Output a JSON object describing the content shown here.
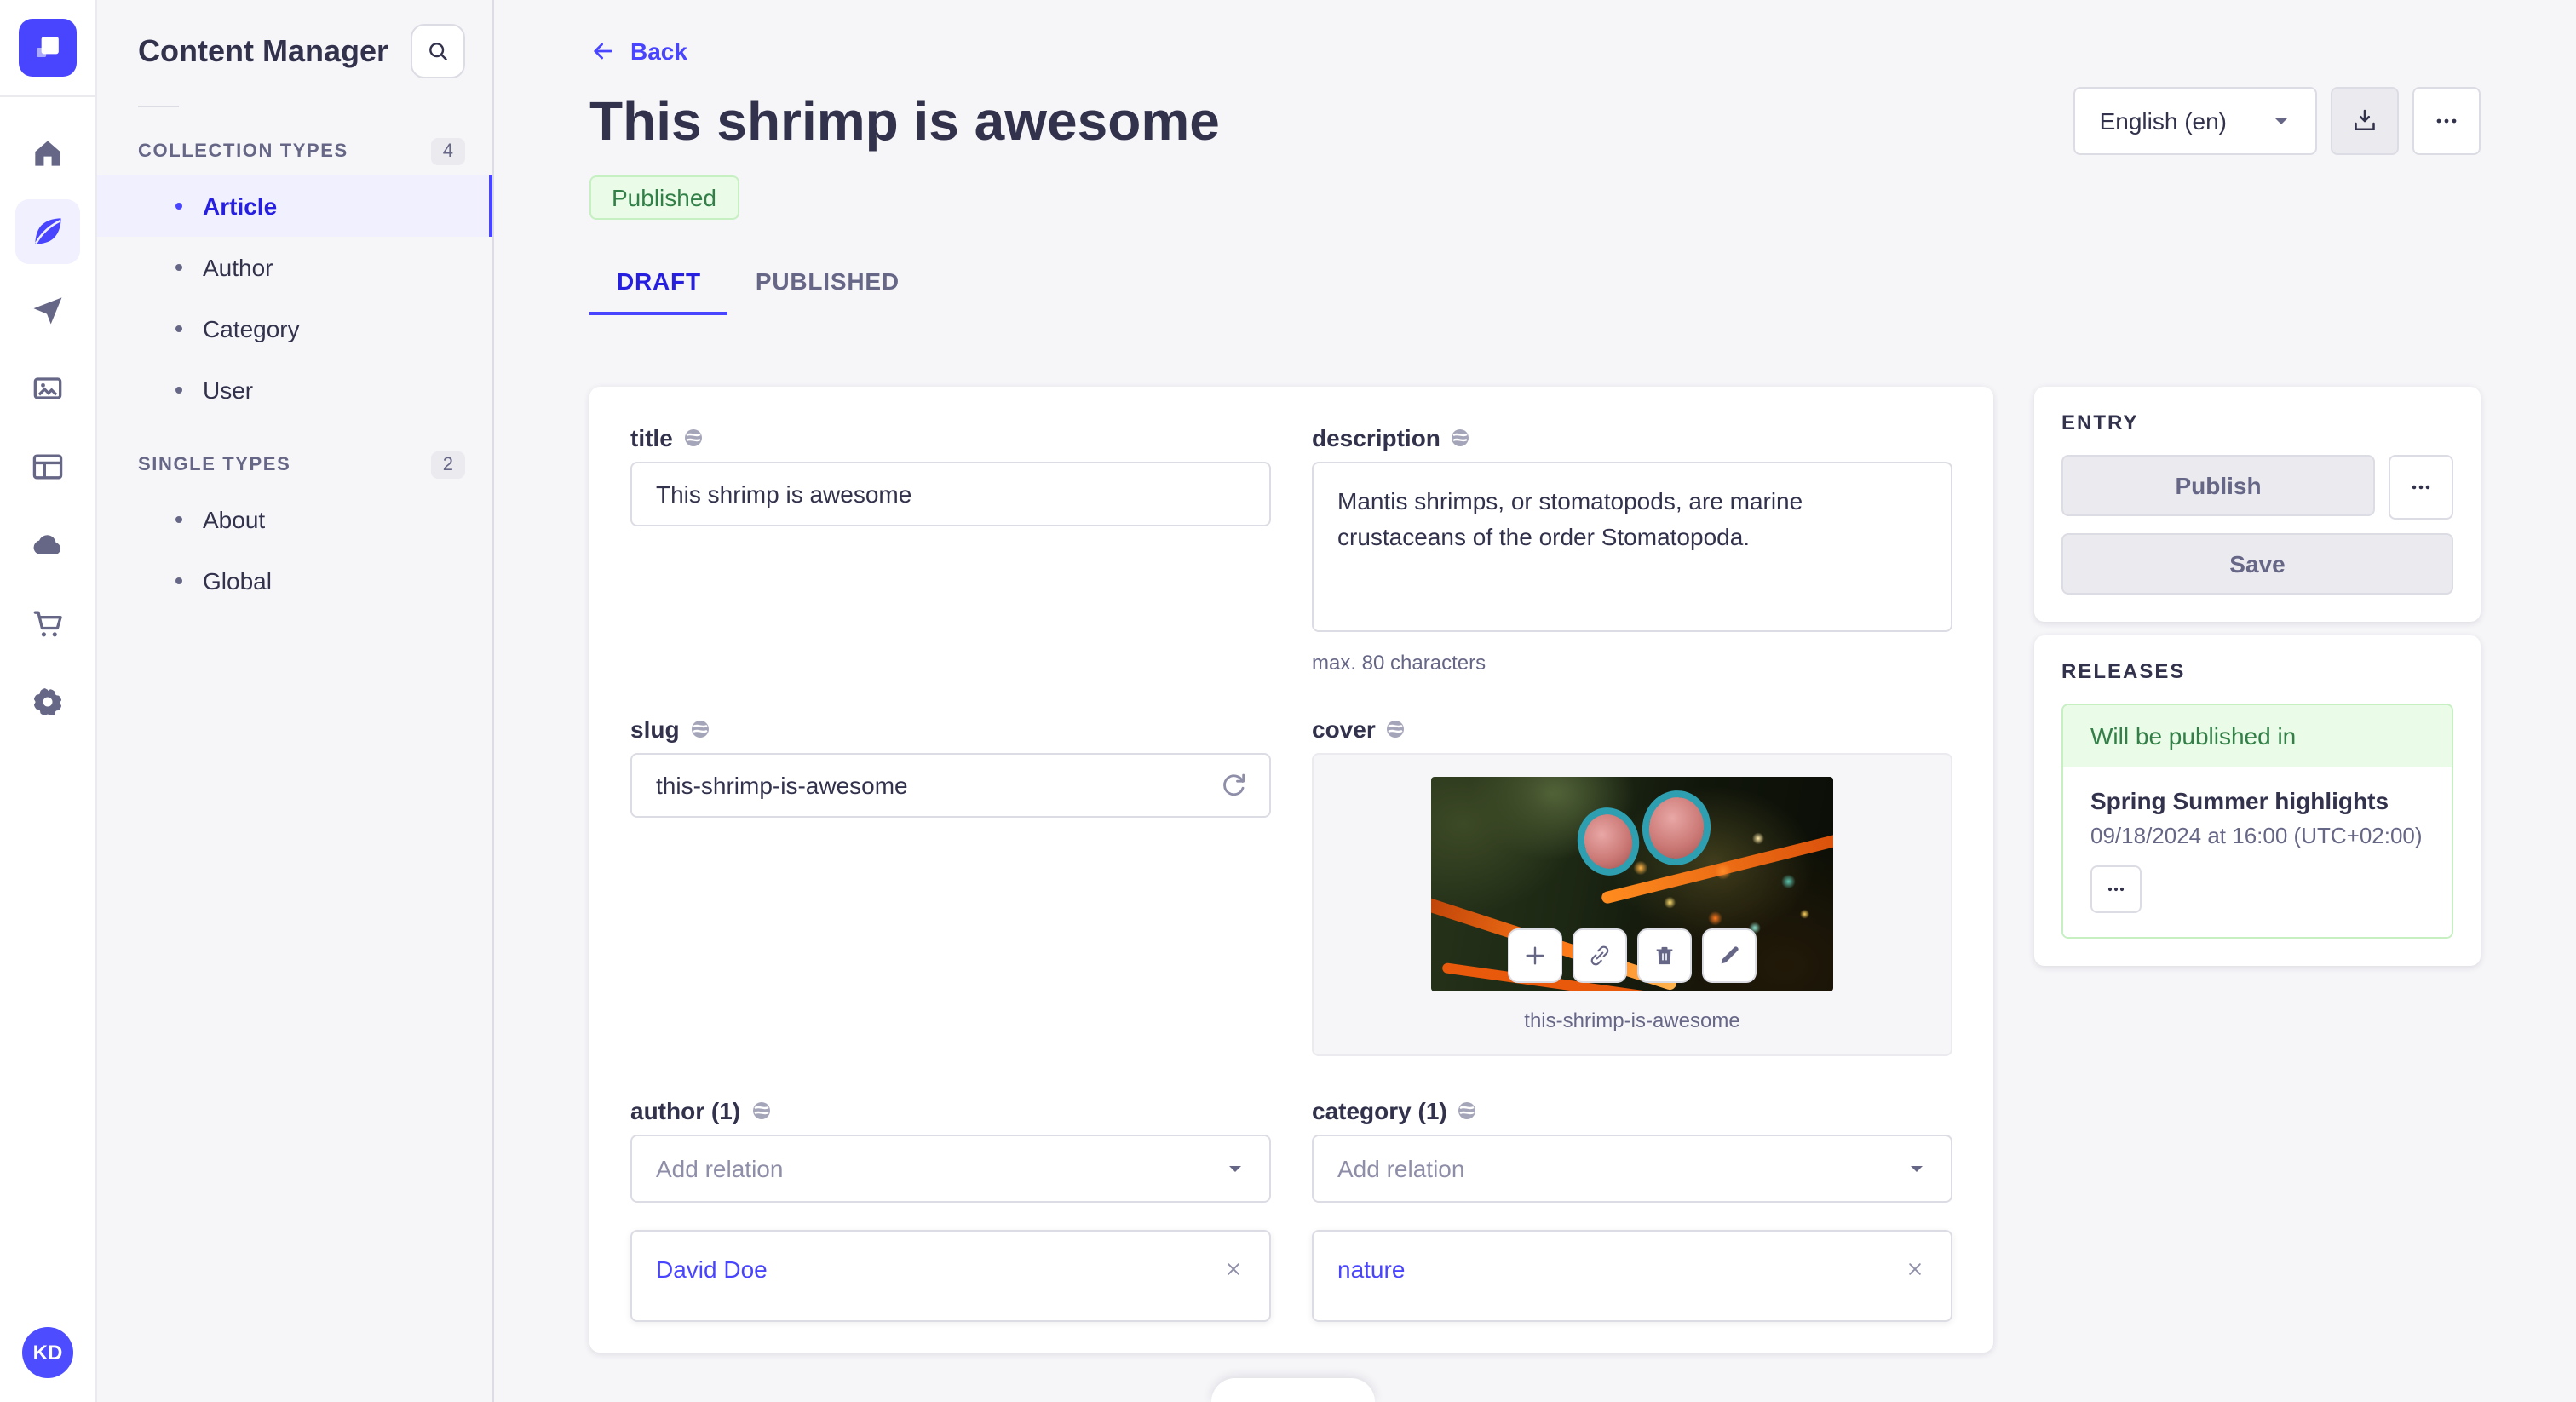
{
  "user": {
    "initials": "KD"
  },
  "sidebar": {
    "title": "Content Manager",
    "sections": [
      {
        "label": "COLLECTION TYPES",
        "count": "4",
        "items": [
          {
            "label": "Article"
          },
          {
            "label": "Author"
          },
          {
            "label": "Category"
          },
          {
            "label": "User"
          }
        ]
      },
      {
        "label": "SINGLE TYPES",
        "count": "2",
        "items": [
          {
            "label": "About"
          },
          {
            "label": "Global"
          }
        ]
      }
    ]
  },
  "header": {
    "back": "Back",
    "title": "This shrimp is awesome",
    "status": "Published",
    "locale": "English (en)"
  },
  "tabs": {
    "items": [
      {
        "label": "DRAFT"
      },
      {
        "label": "PUBLISHED"
      }
    ]
  },
  "form": {
    "title": {
      "label": "title",
      "value": "This shrimp is awesome"
    },
    "description": {
      "label": "description",
      "value": "Mantis shrimps, or stomatopods, are marine crustaceans of the order Stomatopoda.",
      "hint": "max. 80 characters"
    },
    "slug": {
      "label": "slug",
      "value": "this-shrimp-is-awesome"
    },
    "cover": {
      "label": "cover",
      "caption": "this-shrimp-is-awesome"
    },
    "author": {
      "label": "author (1)",
      "placeholder": "Add relation",
      "relation": "David Doe"
    },
    "category": {
      "label": "category (1)",
      "placeholder": "Add relation",
      "relation": "nature"
    }
  },
  "entry_panel": {
    "title": "ENTRY",
    "publish": "Publish",
    "save": "Save"
  },
  "releases_panel": {
    "title": "RELEASES",
    "status": "Will be published in",
    "release_name": "Spring Summer highlights",
    "release_date": "09/18/2024 at 16:00 (UTC+02:00)"
  },
  "colors": {
    "primary": "#4945ff",
    "primary_dark": "#271fe0",
    "primary_light_bg": "#f0f0ff",
    "success_text": "#328048",
    "success_bg": "#eafbe7",
    "success_border": "#c6f0c2",
    "text_dark": "#32324d",
    "text_grey": "#666687",
    "border_grey": "#dcdce4",
    "page_bg": "#f6f6f9"
  }
}
